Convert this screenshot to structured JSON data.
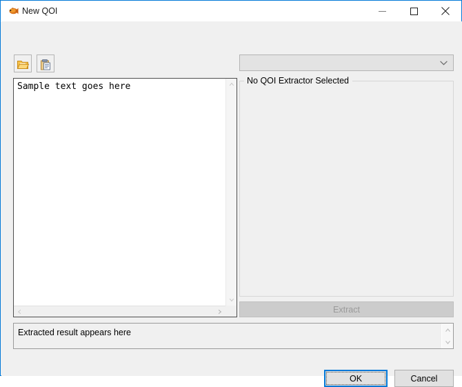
{
  "window": {
    "title": "New QOI",
    "icon": "fish-icon",
    "accent_color": "#0078d7",
    "controls": {
      "minimize": "minimize-icon",
      "maximize": "maximize-icon",
      "close": "close-icon"
    }
  },
  "toolbar": {
    "open_label": "open-folder-icon",
    "paste_label": "clipboard-paste-icon"
  },
  "source_text": {
    "value": "Sample text goes here",
    "scrollbars": {
      "up": "▲",
      "down": "▼",
      "left": "◀",
      "right": "▶"
    }
  },
  "extractor": {
    "combo_value": "",
    "combo_placeholder": "",
    "combo_arrow": "chevron-down-icon",
    "group_label": "No QOI Extractor Selected",
    "extract_button": "Extract"
  },
  "result": {
    "value": "Extracted result appears here",
    "spin_up": "▲",
    "spin_down": "▼"
  },
  "footer": {
    "ok_label": "OK",
    "cancel_label": "Cancel"
  }
}
